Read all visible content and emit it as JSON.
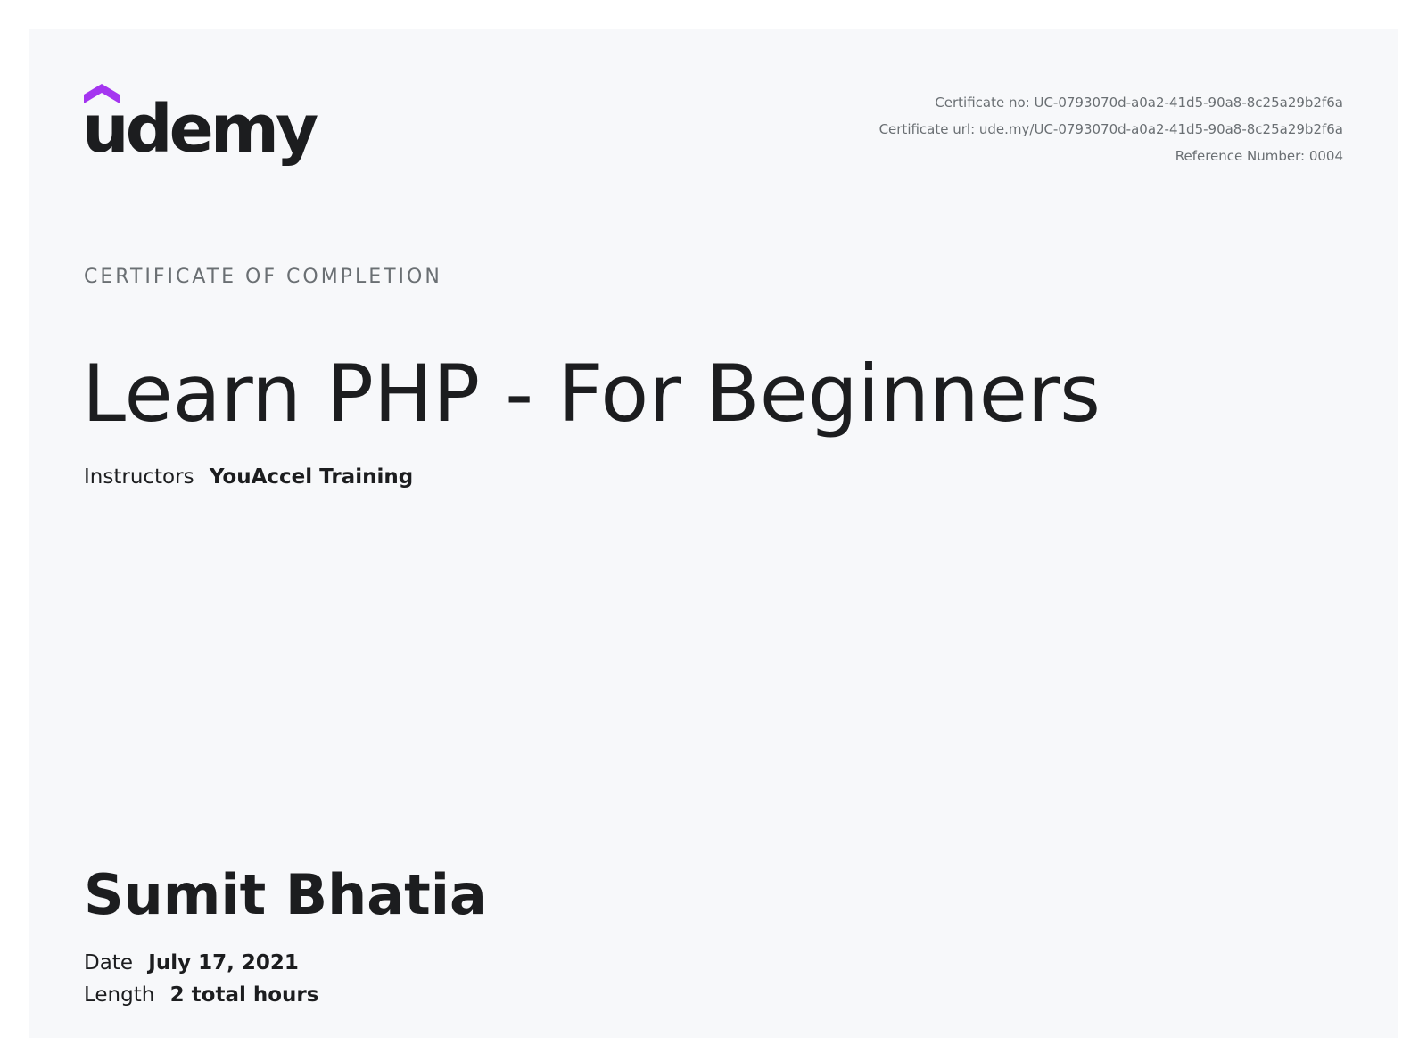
{
  "header": {
    "logo_text": "udemy",
    "certificate_no": "Certificate no: UC-0793070d-a0a2-41d5-90a8-8c25a29b2f6a",
    "certificate_url": "Certificate url: ude.my/UC-0793070d-a0a2-41d5-90a8-8c25a29b2f6a",
    "reference_number": "Reference Number: 0004"
  },
  "certificate": {
    "kicker": "CERTIFICATE OF COMPLETION",
    "course_title": "Learn PHP - For Beginners",
    "instructors_label": "Instructors",
    "instructors_value": "YouAccel Training",
    "student_name": "Sumit Bhatia",
    "date_label": "Date",
    "date_value": "July 17, 2021",
    "length_label": "Length",
    "length_value": "2 total hours"
  },
  "colors": {
    "brand_purple": "#a435f0",
    "text_dark": "#1c1d1f",
    "text_muted": "#6a6f73",
    "card_background": "#f7f8fa"
  },
  "icons": {
    "logo": "udemy-logo"
  }
}
